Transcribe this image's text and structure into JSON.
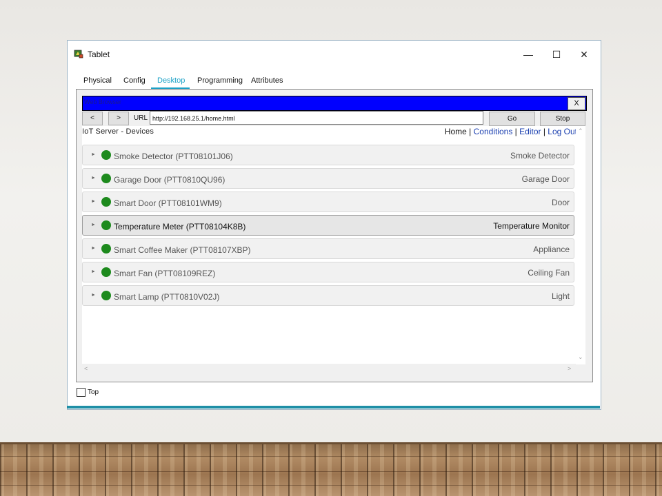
{
  "window": {
    "title": "Tablet",
    "controls": {
      "minimize": "—",
      "maximize": "☐",
      "close": "✕"
    }
  },
  "tabs": [
    {
      "label": "Physical",
      "active": false
    },
    {
      "label": "Config",
      "active": false
    },
    {
      "label": "Desktop",
      "active": true
    },
    {
      "label": "Programming",
      "active": false
    },
    {
      "label": "Attributes",
      "active": false
    }
  ],
  "browser": {
    "title": "Web Browser",
    "close_label": "X",
    "back_label": "<",
    "forward_label": ">",
    "url_label": "URL",
    "url_value": "http://192.168.25.1/home.html",
    "go_label": "Go",
    "stop_label": "Stop"
  },
  "page": {
    "title": "IoT Server - Devices",
    "nav": {
      "home": "Home",
      "sep1": " | ",
      "conditions": "Conditions",
      "sep2": " | ",
      "editor": "Editor",
      "sep3": " | ",
      "logout": "Log Out"
    }
  },
  "devices": [
    {
      "name": "Smoke Detector (PTT08101J06)",
      "type": "Smoke Detector",
      "status": "online"
    },
    {
      "name": "Garage Door (PTT0810QU96)",
      "type": "Garage Door",
      "status": "online"
    },
    {
      "name": "Smart Door (PTT08101WM9)",
      "type": "Door",
      "status": "online"
    },
    {
      "name": "Temperature Meter (PTT08104K8B)",
      "type": "Temperature Monitor",
      "status": "online",
      "highlighted": true
    },
    {
      "name": "Smart Coffee Maker (PTT08107XBP)",
      "type": "Appliance",
      "status": "online"
    },
    {
      "name": "Smart Fan (PTT08109REZ)",
      "type": "Ceiling Fan",
      "status": "online"
    },
    {
      "name": "Smart Lamp (PTT0810V02J)",
      "type": "Light",
      "status": "online"
    }
  ],
  "footer": {
    "top_label": "Top",
    "top_checked": false
  },
  "colors": {
    "accent": "#1ba1c6",
    "browser_titlebar": "#0000ff",
    "status_online": "#1d8a1d",
    "link": "#1a3fb0"
  },
  "icons": {
    "app": "tablet-app-icon",
    "row_caret": "caret-right-icon",
    "status": "status-dot-icon"
  }
}
